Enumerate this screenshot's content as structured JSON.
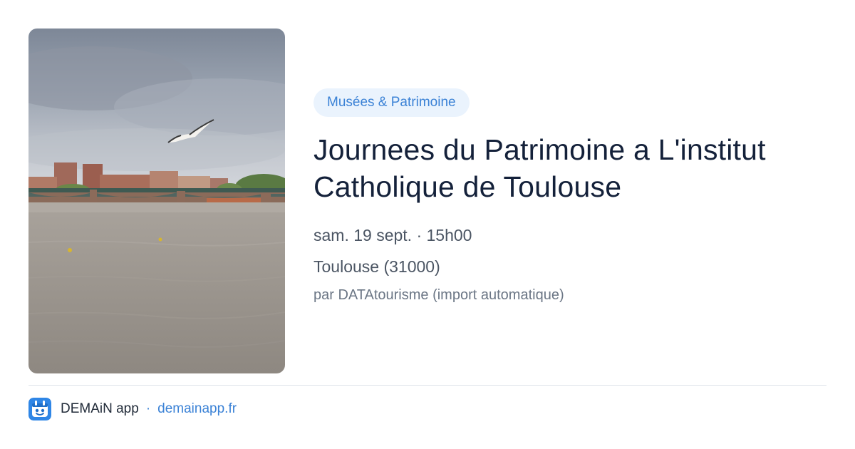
{
  "event": {
    "category": "Musées & Patrimoine",
    "title": "Journees du Patrimoine a L'institut Catholique de Toulouse",
    "datetime": "sam. 19 sept. · 15h00",
    "location": "Toulouse (31000)",
    "source": "par DATAtourisme (import automatique)"
  },
  "footer": {
    "app_name": "DEMAiN app",
    "separator": "·",
    "url": "demainapp.fr"
  },
  "icons": {
    "app": "demain-app-logo-icon"
  },
  "colors": {
    "accent": "#3b82d6",
    "badge_bg": "#eaf3fd",
    "title": "#14213a",
    "muted": "#6b7685"
  }
}
